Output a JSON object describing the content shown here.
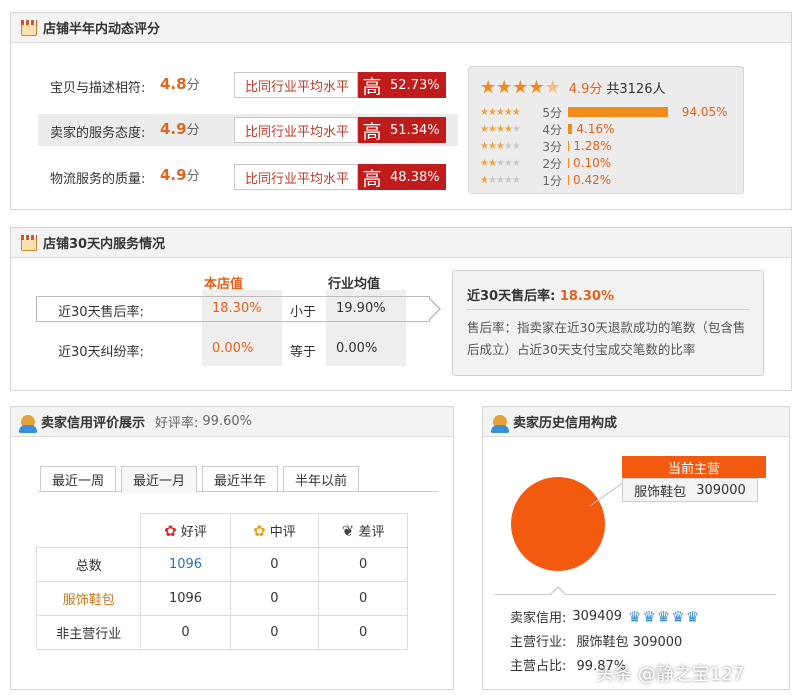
{
  "shop_rating": {
    "title": "店铺半年内动态评分",
    "rows": [
      {
        "label": "宝贝与描述相符:",
        "score": "4.8",
        "unit": "分",
        "compare": "比同行业平均水平",
        "level": "高",
        "pct": "52.73%"
      },
      {
        "label": "卖家的服务态度:",
        "score": "4.9",
        "unit": "分",
        "compare": "比同行业平均水平",
        "level": "高",
        "pct": "51.34%"
      },
      {
        "label": "物流服务的质量:",
        "score": "4.9",
        "unit": "分",
        "compare": "比同行业平均水平",
        "level": "高",
        "pct": "48.38%"
      }
    ],
    "summary": {
      "score": "4.9分",
      "people": "共3126人",
      "stars_fraction": 0.98
    },
    "dist": [
      {
        "level": "5分",
        "pct": "94.05%",
        "value": 94.05
      },
      {
        "level": "4分",
        "pct": "4.16%",
        "value": 4.16
      },
      {
        "level": "3分",
        "pct": "1.28%",
        "value": 1.28
      },
      {
        "level": "2分",
        "pct": "0.10%",
        "value": 0.1
      },
      {
        "level": "1分",
        "pct": "0.42%",
        "value": 0.42
      }
    ]
  },
  "service": {
    "title": "店铺30天内服务情况",
    "col_shop": "本店值",
    "col_avg": "行业均值",
    "rows": [
      {
        "label": "近30天售后率:",
        "shop": "18.30%",
        "cmp": "小于",
        "avg": "19.90%"
      },
      {
        "label": "近30天纠纷率:",
        "shop": "0.00%",
        "cmp": "等于",
        "avg": "0.00%"
      }
    ],
    "tip_title": "近30天售后率:",
    "tip_value": "18.30%",
    "tip_desc": "售后率：指卖家在近30天退款成功的笔数（包含售后成立）占近30天支付宝成交笔数的比率"
  },
  "credit": {
    "title": "卖家信用评价展示",
    "good_rate_label": "好评率:",
    "good_rate": "99.60%",
    "tabs": [
      "最近一周",
      "最近一月",
      "最近半年",
      "半年以前"
    ],
    "active_tab": 1,
    "headers": [
      "好评",
      "中评",
      "差评"
    ],
    "rows": [
      {
        "label": "总数",
        "good": "1096",
        "mid": "0",
        "bad": "0"
      },
      {
        "label": "服饰鞋包",
        "good": "1096",
        "mid": "0",
        "bad": "0"
      },
      {
        "label": "非主营行业",
        "good": "0",
        "mid": "0",
        "bad": "0"
      }
    ]
  },
  "history": {
    "title": "卖家历史信用构成",
    "current_label": "当前主营",
    "category": "服饰鞋包",
    "category_value": "309000",
    "seller_credit_label": "卖家信用:",
    "seller_credit": "309409",
    "main_label": "主营行业:",
    "main_value": "服饰鞋包 309000",
    "share_label": "主营占比:",
    "share_value": "99.87%",
    "pie_fraction": 0.9987
  },
  "watermark": "头条 @静之宝127"
}
